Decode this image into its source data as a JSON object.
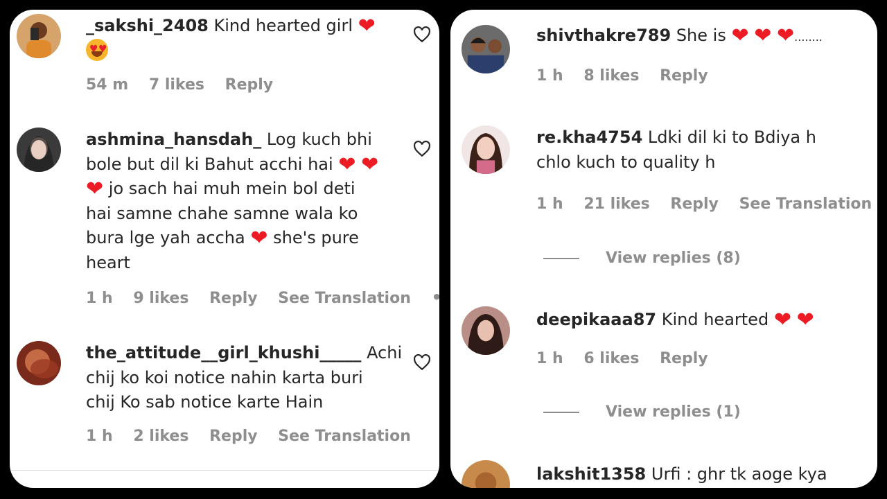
{
  "left_panel": {
    "comments": [
      {
        "username": "_sakshi_2408",
        "text": "Kind hearted girl",
        "time": "54 m",
        "likes": "7 likes",
        "reply": "Reply"
      },
      {
        "username": "ashmina_hansdah_",
        "text_1": "Log kuch bhi",
        "text_2": "bole but dil ki Bahut acchi hai",
        "text_3": "jo sach hai muh mein bol deti",
        "text_4": "hai samne chahe samne wala ko",
        "text_5": "bura lge yah accha",
        "text_5b": "she's pure",
        "text_6": "heart",
        "time": "1 h",
        "likes": "9 likes",
        "reply": "Reply",
        "translation": "See Translation",
        "more": "•••"
      },
      {
        "username": "the_attitude__girl_khushi_____",
        "text_1": "Achi",
        "text_2": "chij ko koi notice nahin karta buri",
        "text_3": "chij Ko sab notice karte Hain",
        "time": "1 h",
        "likes": "2 likes",
        "reply": "Reply",
        "translation": "See Translation"
      }
    ]
  },
  "right_panel": {
    "comments": [
      {
        "username": "shivthakre789",
        "text": "She is",
        "trail": "........",
        "time": "1 h",
        "likes": "8 likes",
        "reply": "Reply"
      },
      {
        "username": "re.kha4754",
        "text_1": "Ldki dil ki to Bdiya h",
        "text_2": "chlo kuch to quality h",
        "time": "1 h",
        "likes": "21 likes",
        "reply": "Reply",
        "translation": "See Translation",
        "view_replies": "View replies (8)"
      },
      {
        "username": "deepikaaa87",
        "text": "Kind hearted",
        "time": "1 h",
        "likes": "6 likes",
        "reply": "Reply",
        "view_replies": "View replies (1)"
      },
      {
        "username": "lakshit1358",
        "text": "Urfi : ghr tk aoge kya"
      }
    ]
  },
  "icons": {
    "heart_emoji": "❤",
    "like": "heart-outline-icon"
  },
  "colors": {
    "background": "#000000",
    "panel": "#ffffff",
    "text": "#262626",
    "muted": "#8e8e8e",
    "heart": "#ed1c24"
  }
}
